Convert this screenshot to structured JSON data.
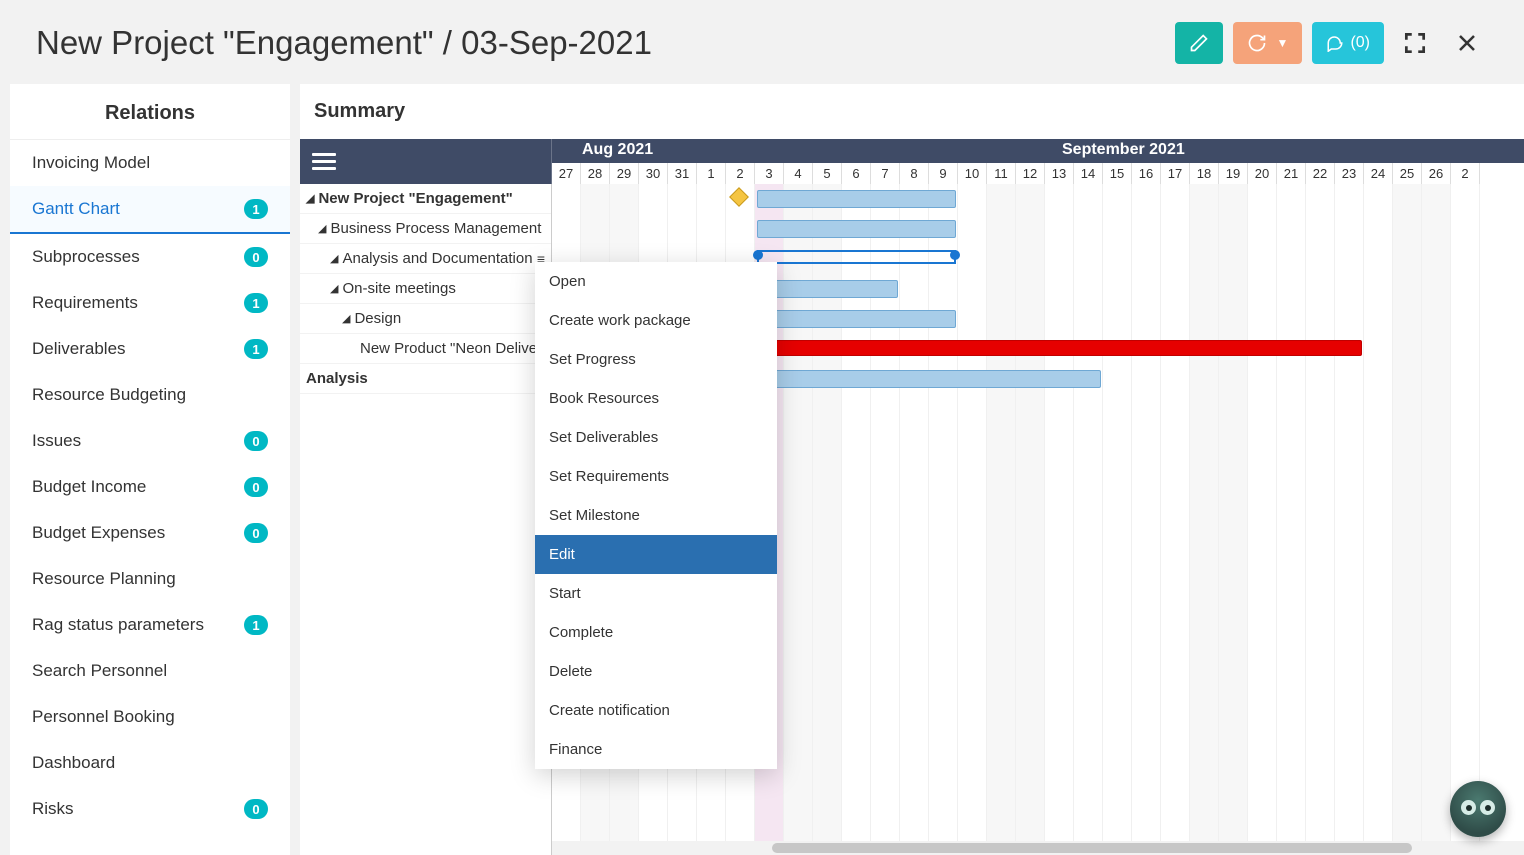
{
  "header": {
    "title": "New Project \"Engagement\" / 03-Sep-2021",
    "comments_label": "(0)"
  },
  "sidebar": {
    "title": "Relations",
    "items": [
      {
        "label": "Invoicing Model",
        "badge": null,
        "active": false
      },
      {
        "label": "Gantt Chart",
        "badge": "1",
        "active": true
      },
      {
        "label": "Subprocesses",
        "badge": "0",
        "active": false
      },
      {
        "label": "Requirements",
        "badge": "1",
        "active": false
      },
      {
        "label": "Deliverables",
        "badge": "1",
        "active": false
      },
      {
        "label": "Resource Budgeting",
        "badge": null,
        "active": false
      },
      {
        "label": "Issues",
        "badge": "0",
        "active": false
      },
      {
        "label": "Budget Income",
        "badge": "0",
        "active": false
      },
      {
        "label": "Budget Expenses",
        "badge": "0",
        "active": false
      },
      {
        "label": "Resource Planning",
        "badge": null,
        "active": false
      },
      {
        "label": "Rag status parameters",
        "badge": "1",
        "active": false
      },
      {
        "label": "Search Personnel",
        "badge": null,
        "active": false
      },
      {
        "label": "Personnel Booking",
        "badge": null,
        "active": false
      },
      {
        "label": "Dashboard",
        "badge": null,
        "active": false
      },
      {
        "label": "Risks",
        "badge": "0",
        "active": false
      }
    ]
  },
  "main": {
    "title": "Summary"
  },
  "gantt": {
    "months": [
      "Aug 2021",
      "September 2021"
    ],
    "days": [
      "27",
      "28",
      "29",
      "30",
      "31",
      "1",
      "2",
      "3",
      "4",
      "5",
      "6",
      "7",
      "8",
      "9",
      "10",
      "11",
      "12",
      "13",
      "14",
      "15",
      "16",
      "17",
      "18",
      "19",
      "20",
      "21",
      "22",
      "23",
      "24",
      "25",
      "26",
      "2"
    ],
    "weekend_idx": [
      1,
      2,
      8,
      9,
      15,
      16,
      22,
      23,
      29,
      30
    ],
    "today_idx": 7,
    "tasks": [
      {
        "level": 0,
        "label": "New Project \"Engagement\"",
        "expandable": true
      },
      {
        "level": 1,
        "label": "Business Process Management",
        "expandable": true
      },
      {
        "level": 2,
        "label": "Analysis and Documentation",
        "expandable": true,
        "menu": true
      },
      {
        "level": 2,
        "label": "On-site meetings",
        "expandable": true
      },
      {
        "level": 3,
        "label": "Design",
        "expandable": true
      },
      {
        "level": 4,
        "label": "New Product \"Neon Delive...",
        "expandable": false
      },
      {
        "level": 0,
        "label": "Analysis",
        "expandable": false,
        "plain": true
      }
    ]
  },
  "context_menu": {
    "items": [
      {
        "label": "Open",
        "hovered": false
      },
      {
        "label": "Create work package",
        "hovered": false
      },
      {
        "label": "Set Progress",
        "hovered": false
      },
      {
        "label": "Book Resources",
        "hovered": false
      },
      {
        "label": "Set Deliverables",
        "hovered": false
      },
      {
        "label": "Set Requirements",
        "hovered": false
      },
      {
        "label": "Set Milestone",
        "hovered": false
      },
      {
        "label": "Edit",
        "hovered": true
      },
      {
        "label": "Start",
        "hovered": false
      },
      {
        "label": "Complete",
        "hovered": false
      },
      {
        "label": "Delete",
        "hovered": false
      },
      {
        "label": "Create notification",
        "hovered": false
      },
      {
        "label": "Finance",
        "hovered": false
      }
    ]
  },
  "chart_data": {
    "type": "gantt",
    "x_unit": "day",
    "x_start": "2021-08-27",
    "x_end": "2021-09-27",
    "bars": [
      {
        "task": "New Project \"Engagement\"",
        "start": "2021-09-03",
        "end": "2021-09-10",
        "style": "blue"
      },
      {
        "task": "Business Process Management",
        "start": "2021-09-03",
        "end": "2021-09-10",
        "style": "blue"
      },
      {
        "task": "Analysis and Documentation",
        "start": "2021-09-03",
        "end": "2021-09-10",
        "style": "summary-outline"
      },
      {
        "task": "On-site meetings",
        "start": "2021-09-03",
        "end": "2021-09-08",
        "style": "blue"
      },
      {
        "task": "Design",
        "start": "2021-09-03",
        "end": "2021-09-10",
        "style": "blue"
      },
      {
        "task": "New Product \"Neon Delive...\"",
        "start": "2021-09-03",
        "end": "2021-09-24",
        "style": "red"
      },
      {
        "task": "Analysis",
        "start": "2021-09-03",
        "end": "2021-09-15",
        "style": "blue"
      }
    ],
    "milestones": [
      {
        "task": "New Project \"Engagement\"",
        "date": "2021-09-02"
      }
    ]
  }
}
